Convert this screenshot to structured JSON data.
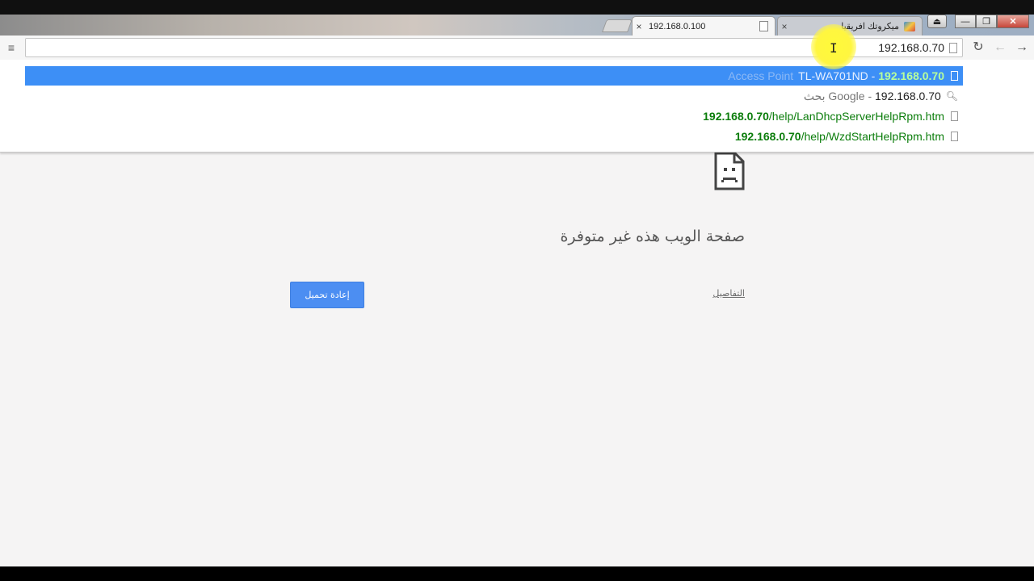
{
  "browser": {
    "tabs": [
      {
        "title": "192.168.0.100",
        "active": true,
        "close": "×"
      },
      {
        "title": "ميكروتك افريقيا",
        "active": false,
        "close": "×"
      }
    ],
    "window_controls": {
      "minimize": "—",
      "maximize": "❐",
      "close": "✕",
      "user": "⏏"
    },
    "toolbar": {
      "menu": "≡",
      "reload": "↻",
      "back": "←",
      "forward": "→"
    },
    "omnibox": {
      "value": "192.168.0.70"
    },
    "suggestions": [
      {
        "host": "192.168.0.70",
        "sep": " - ",
        "title": "TL-WA701ND",
        "extra": "Access Point",
        "kind": "page",
        "selected": true
      },
      {
        "host": "192.168.0.70",
        "sep": " - ",
        "title": "بحث Google",
        "kind": "search",
        "selected": false
      },
      {
        "host": "192.168.0.70",
        "path": "/help/LanDhcpServerHelpRpm.htm",
        "kind": "page",
        "selected": false
      },
      {
        "host": "192.168.0.70",
        "path": "/help/WzdStartHelpRpm.htm",
        "kind": "page",
        "selected": false
      }
    ]
  },
  "error_page": {
    "title": "صفحة الويب هذه غير متوفرة",
    "details_link": "التفاصيل",
    "reload_button": "إعادة تحميل"
  },
  "colors": {
    "accent": "#3d8ff6",
    "button": "#4c8ef2",
    "url_green": "#0b7d0b",
    "background": "#f5f4f4"
  }
}
